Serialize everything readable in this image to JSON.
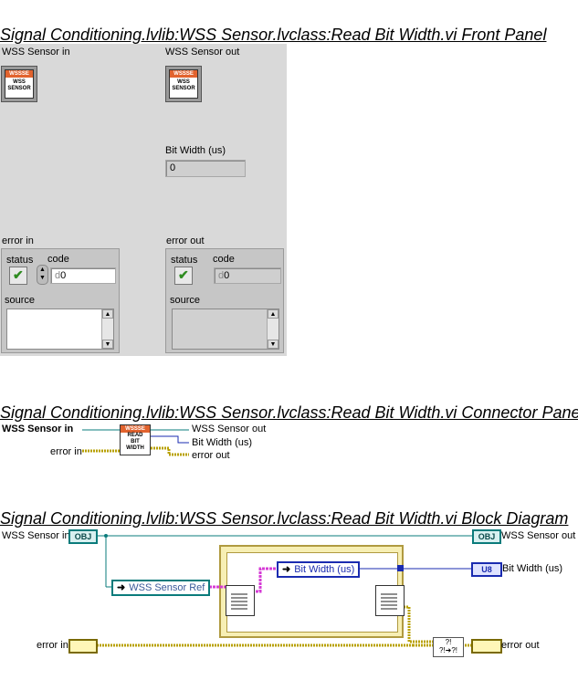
{
  "front_panel": {
    "title": "Signal Conditioning.lvlib:WSS Sensor.lvclass:Read Bit Width.vi Front Panel",
    "wss_in_label": "WSS Sensor in",
    "wss_out_label": "WSS Sensor out",
    "icon_header": "WSSSE",
    "icon_text_1": "WSS",
    "icon_text_2": "SENSOR",
    "bit_width_label": "Bit Width (us)",
    "bit_width_value": "0",
    "error_in": {
      "label": "error in",
      "status_label": "status",
      "code_label": "code",
      "code_value": "0",
      "source_label": "source",
      "code_radix": "d"
    },
    "error_out": {
      "label": "error out",
      "status_label": "status",
      "code_label": "code",
      "code_value": "0",
      "source_label": "source",
      "code_radix": "d"
    }
  },
  "connector_pane": {
    "title": "Signal Conditioning.lvlib:WSS Sensor.lvclass:Read Bit Width.vi Connector Pane",
    "in_wss": "WSS Sensor in",
    "in_error": "error in",
    "out_wss": "WSS Sensor out",
    "out_bit_width": "Bit Width (us)",
    "out_error": "error out",
    "icon_header": "WSSSE",
    "icon_text_1": "READ",
    "icon_text_2": "BIT",
    "icon_text_3": "WIDTH"
  },
  "block_diagram": {
    "title": "Signal Conditioning.lvlib:WSS Sensor.lvclass:Read Bit Width.vi Block Diagram",
    "wss_in": "WSS Sensor in",
    "wss_out": "WSS Sensor out",
    "obj_tag": "OBJ",
    "u8_tag": "U8",
    "ref_node": "WSS Sensor Ref",
    "prop_node": "Bit Width (us)",
    "bit_width_out": "Bit Width (us)",
    "error_in": "error in",
    "error_out": "error out"
  },
  "colors": {
    "class_wire": "#0a7b7b",
    "ref_wire": "#d63bd6",
    "u8_wire": "#1a2bb0",
    "error_wire": "#b8a000",
    "icon_header": "#e2632e"
  }
}
